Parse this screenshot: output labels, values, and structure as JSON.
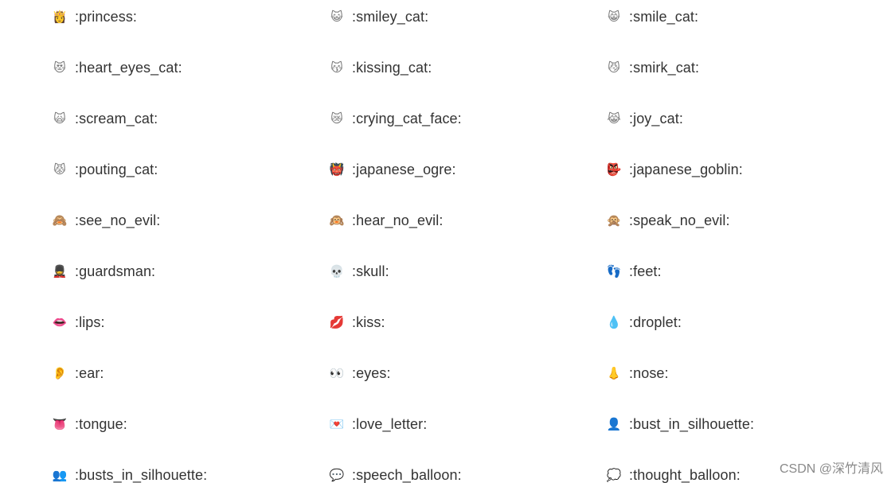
{
  "emojis": [
    ":princess:",
    ":smiley_cat:",
    ":smile_cat:",
    ":heart_eyes_cat:",
    ":kissing_cat:",
    ":smirk_cat:",
    ":scream_cat:",
    ":crying_cat_face:",
    ":joy_cat:",
    ":pouting_cat:",
    ":japanese_ogre:",
    ":japanese_goblin:",
    ":see_no_evil:",
    ":hear_no_evil:",
    ":speak_no_evil:",
    ":guardsman:",
    ":skull:",
    ":feet:",
    ":lips:",
    ":kiss:",
    ":droplet:",
    ":ear:",
    ":eyes:",
    ":nose:",
    ":tongue:",
    ":love_letter:",
    ":bust_in_silhouette:",
    ":busts_in_silhouette:",
    ":speech_balloon:",
    ":thought_balloon:"
  ],
  "icons": [
    "princess-icon",
    "smiley-cat-icon",
    "smile-cat-icon",
    "heart-eyes-cat-icon",
    "kissing-cat-icon",
    "smirk-cat-icon",
    "scream-cat-icon",
    "crying-cat-face-icon",
    "joy-cat-icon",
    "pouting-cat-icon",
    "japanese-ogre-icon",
    "japanese-goblin-icon",
    "see-no-evil-icon",
    "hear-no-evil-icon",
    "speak-no-evil-icon",
    "guardsman-icon",
    "skull-icon",
    "feet-icon",
    "lips-icon",
    "kiss-icon",
    "droplet-icon",
    "ear-icon",
    "eyes-icon",
    "nose-icon",
    "tongue-icon",
    "love-letter-icon",
    "bust-in-silhouette-icon",
    "busts-in-silhouette-icon",
    "speech-balloon-icon",
    "thought-balloon-icon"
  ],
  "watermark": "CSDN @深竹清风"
}
